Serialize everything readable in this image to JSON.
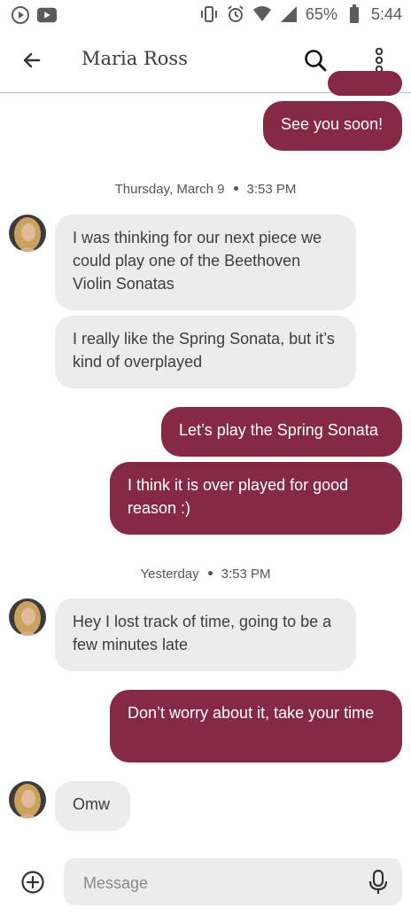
{
  "status_bar": {
    "battery_percent": "65%",
    "time": "5:44"
  },
  "header": {
    "contact_name": "Maria Ross"
  },
  "conversation": {
    "earlier": {
      "messages": [
        {
          "direction": "outgoing",
          "text": "See you soon!"
        }
      ]
    },
    "section1": {
      "date": "Thursday, March 9",
      "time": "3:53 PM",
      "messages": [
        {
          "direction": "incoming",
          "text": "I was thinking for our next piece we could play one of the Beethoven Violin Sonatas"
        },
        {
          "direction": "incoming",
          "text": "I really like the Spring Sonata, but it’s kind of overplayed"
        },
        {
          "direction": "outgoing",
          "text": "Let’s play the Spring Sonata"
        },
        {
          "direction": "outgoing",
          "text": "I think it is over played for good reason :)"
        }
      ]
    },
    "section2": {
      "date": "Yesterday",
      "time": "3:53 PM",
      "messages": [
        {
          "direction": "incoming",
          "text": "Hey I lost track of time, going to be a few minutes late"
        },
        {
          "direction": "outgoing",
          "text": "Don’t worry about it, take your time"
        },
        {
          "direction": "incoming",
          "text": "Omw"
        }
      ]
    }
  },
  "composer": {
    "placeholder": "Message"
  },
  "colors": {
    "outgoing_bubble": "#852944",
    "incoming_bubble": "#ececec"
  }
}
